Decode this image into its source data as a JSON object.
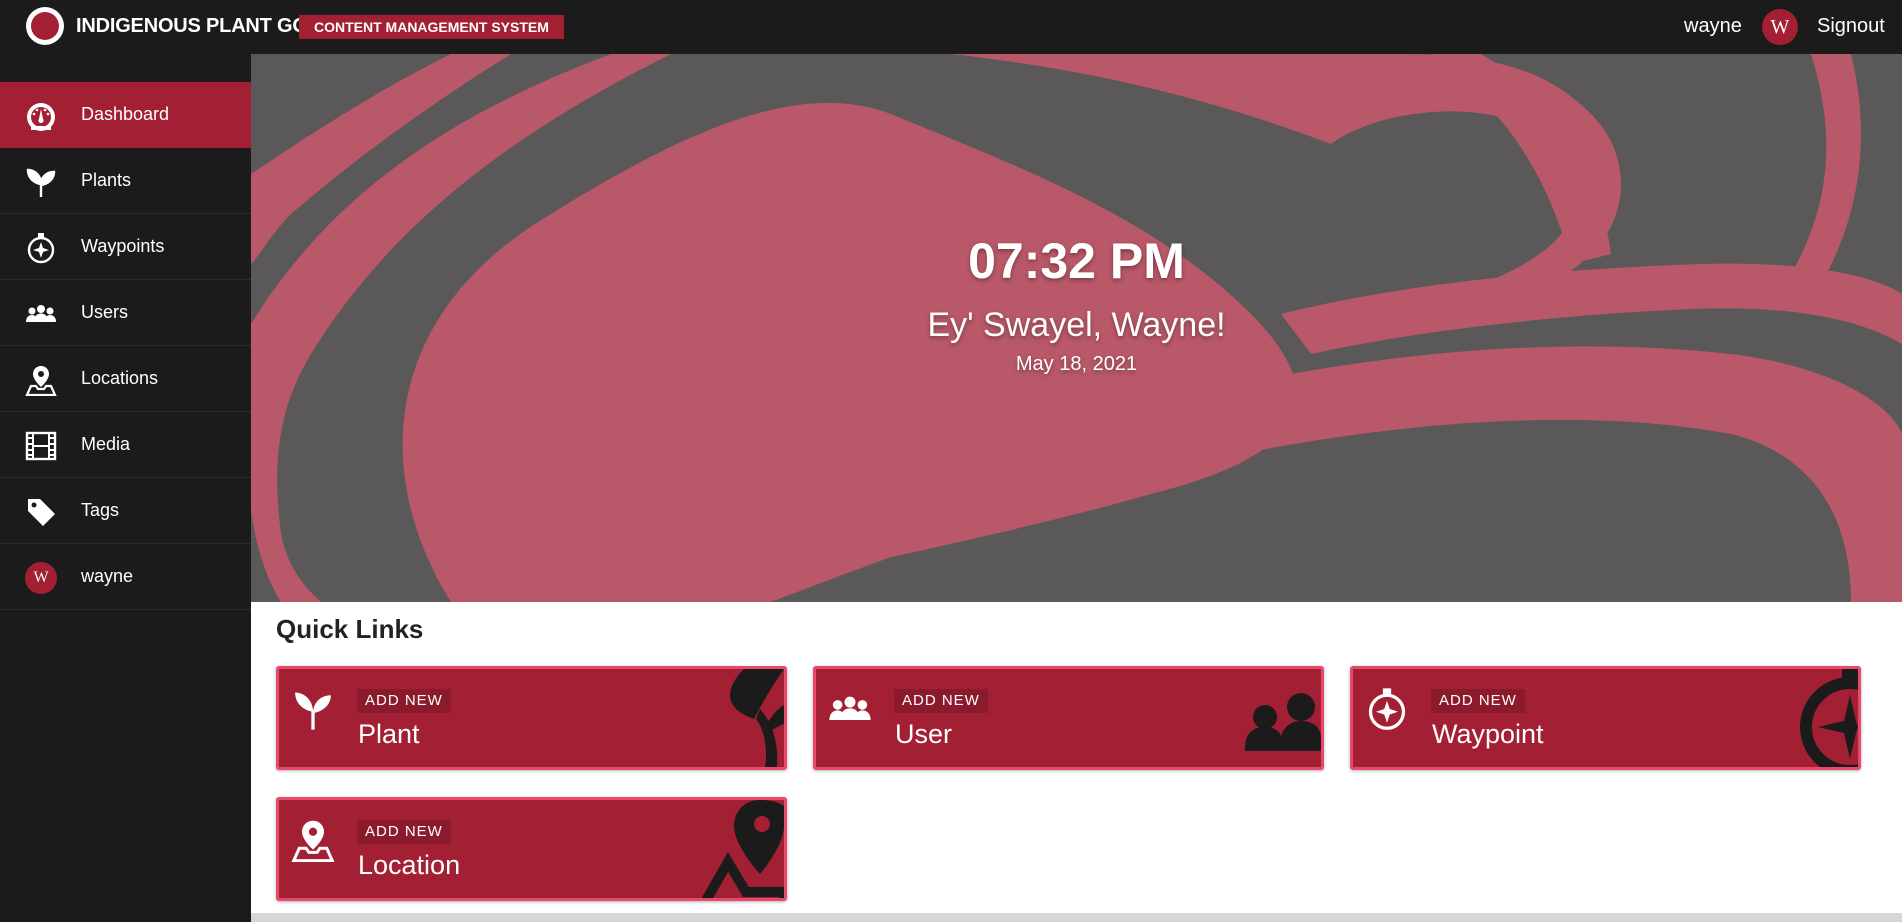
{
  "header": {
    "app_title": "INDIGENOUS PLANT GO",
    "badge": "CONTENT MANAGEMENT SYSTEM",
    "username": "wayne",
    "avatar_initial": "W",
    "signout_label": "Signout"
  },
  "sidebar": {
    "items": [
      {
        "label": "Dashboard",
        "icon": "dashboard-icon",
        "active": true
      },
      {
        "label": "Plants",
        "icon": "plant-icon"
      },
      {
        "label": "Waypoints",
        "icon": "compass-icon"
      },
      {
        "label": "Users",
        "icon": "users-icon"
      },
      {
        "label": "Locations",
        "icon": "location-pin-icon"
      },
      {
        "label": "Media",
        "icon": "film-icon"
      },
      {
        "label": "Tags",
        "icon": "tag-icon"
      },
      {
        "label": "wayne",
        "icon": "avatar",
        "initial": "W"
      }
    ]
  },
  "hero": {
    "time": "07:32 PM",
    "greeting": "Ey' Swayel, Wayne!",
    "date": "May 18, 2021"
  },
  "quick_links": {
    "title": "Quick Links",
    "cards": [
      {
        "badge": "ADD NEW",
        "name": "Plant",
        "icon": "plant-icon"
      },
      {
        "badge": "ADD NEW",
        "name": "User",
        "icon": "users-icon"
      },
      {
        "badge": "ADD NEW",
        "name": "Waypoint",
        "icon": "compass-icon"
      },
      {
        "badge": "ADD NEW",
        "name": "Location",
        "icon": "location-pin-icon"
      }
    ]
  },
  "colors": {
    "accent": "#a31f34",
    "accent_border": "#e8486a",
    "dark": "#1b1b1b",
    "hero_gray": "#5a5858",
    "hero_pink": "#b85868"
  }
}
